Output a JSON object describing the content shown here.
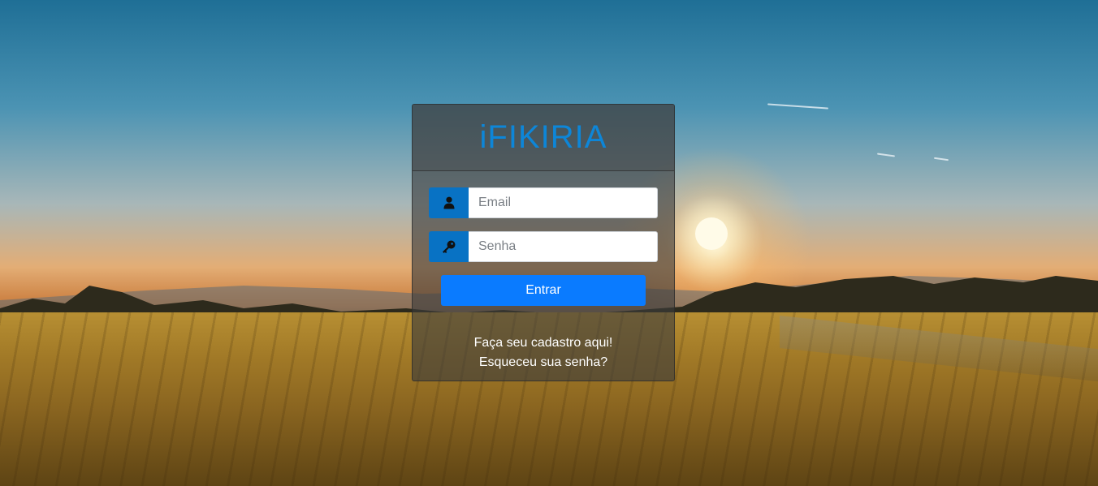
{
  "app": {
    "brand": "iFIKIRIA"
  },
  "login": {
    "email_placeholder": "Email",
    "password_placeholder": "Senha",
    "submit_label": "Entrar",
    "register_link": "Faça seu cadastro aqui!",
    "forgot_link": "Esqueceu sua senha?"
  },
  "icons": {
    "email_addon": "user-icon",
    "password_addon": "key-icon"
  },
  "colors": {
    "brand": "#0d86d8",
    "addon": "#0872c4",
    "primary_button": "#0a7bff"
  }
}
